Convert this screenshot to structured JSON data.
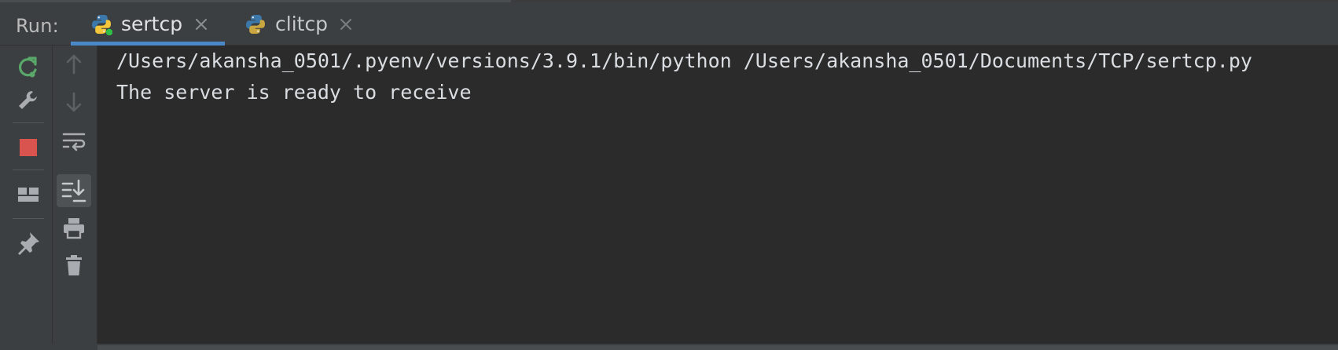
{
  "run_panel": {
    "label": "Run:",
    "tabs": [
      {
        "label": "sertcp",
        "active": true
      },
      {
        "label": "clitcp",
        "active": false
      }
    ]
  },
  "toolbar_left": [
    "rerun-icon",
    "wrench-icon",
    "stop-icon",
    "layout-icon",
    "pin-icon"
  ],
  "toolbar_nav": [
    "arrow-up-icon",
    "arrow-down-icon",
    "soft-wrap-icon",
    "scroll-to-end-icon",
    "print-icon",
    "trash-icon"
  ],
  "console": {
    "lines": [
      "/Users/akansha_0501/.pyenv/versions/3.9.1/bin/python /Users/akansha_0501/Documents/TCP/sertcp.py",
      "The server is ready to receive"
    ]
  },
  "colors": {
    "background": "#2b2b2b",
    "panel": "#3c3f41",
    "tab_underline": "#4a88c7",
    "stop_red": "#d9534f",
    "rerun_green": "#59a869",
    "console_text": "#dadde1"
  }
}
